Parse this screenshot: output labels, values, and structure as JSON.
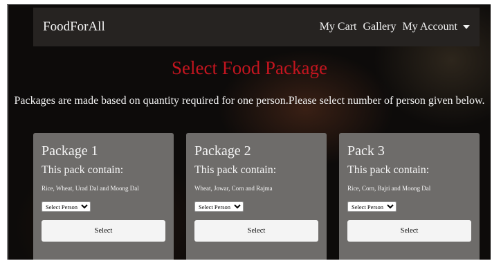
{
  "navbar": {
    "brand": "FoodForAll",
    "links": [
      "My Cart",
      "Gallery",
      "My Account"
    ]
  },
  "page": {
    "title": "Select Food Package",
    "subtitle": "Packages are made based on quantity required for one person.Please select number of person given below."
  },
  "packages": [
    {
      "title": "Package 1",
      "subtitle": "This pack contain:",
      "items": "Rice, Wheat, Urad Dal and Moong Dal",
      "select_value": "Select Person",
      "button": "Select"
    },
    {
      "title": "Package 2",
      "subtitle": "This pack contain:",
      "items": "Wheat, Jowar, Corn and Rajma",
      "select_value": "Select Person",
      "button": "Select"
    },
    {
      "title": "Pack 3",
      "subtitle": "This pack contain:",
      "items": "Rice, Corn, Bajri and Moong Dal",
      "select_value": "Select Person",
      "button": "Select"
    }
  ],
  "colors": {
    "title_red": "#c4151f",
    "navbar_bg": "#262321",
    "card_bg": "#6e6c6a"
  }
}
